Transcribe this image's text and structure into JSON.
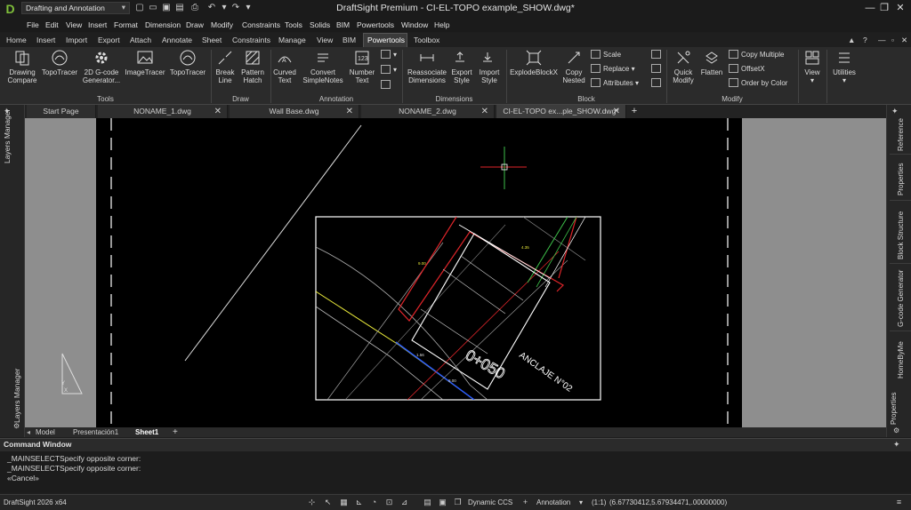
{
  "app": {
    "title": "DraftSight Premium - CI-EL-TOPO example_SHOW.dwg*",
    "workspace": "Drafting and Annotation",
    "version": "DraftSight 2026 x64"
  },
  "menu": [
    "File",
    "Edit",
    "View",
    "Insert",
    "Format",
    "Dimension",
    "Draw",
    "Modify",
    "Constraints",
    "Tools",
    "Solids",
    "BIM",
    "Powertools",
    "Window",
    "Help"
  ],
  "ribbon_tabs": [
    "Home",
    "Insert",
    "Import",
    "Export",
    "Attach",
    "Annotate",
    "Sheet",
    "Constraints",
    "Manage",
    "View",
    "BIM",
    "Powertools",
    "Toolbox"
  ],
  "ribbon": {
    "tools": {
      "label": "Tools",
      "drawing_compare": "Drawing Compare",
      "topotracer": "TopoTracer",
      "gcode": "2D G-code Generator...",
      "imagetracer": "ImageTracer",
      "topotracer2": "TopoTracer"
    },
    "draw": {
      "label": "Draw",
      "break_line": "Break Line",
      "pattern_hatch": "Pattern Hatch"
    },
    "annotation": {
      "label": "Annotation",
      "curved_text": "Curved Text",
      "convert_simplenotes": "Convert SimpleNotes",
      "number_text": "Number Text"
    },
    "dimensions": {
      "label": "Dimensions",
      "reassociate": "Reassociate Dimensions",
      "export_style": "Export Style",
      "import_style": "Import Style"
    },
    "block": {
      "label": "Block",
      "explodeblockx": "ExplodeBlockX",
      "copy_nested": "Copy Nested",
      "scale": "Scale",
      "replace": "Replace",
      "attributes": "Attributes"
    },
    "modify": {
      "label": "Modify",
      "quick_modify": "Quick Modify",
      "flatten": "Flatten",
      "copy_multiple": "Copy Multiple",
      "offsetx": "OffsetX",
      "order_by_color": "Order by Color"
    },
    "view": "View",
    "utilities": "Utilities"
  },
  "doc_tabs": [
    {
      "label": "Start Page"
    },
    {
      "label": "NONAME_1.dwg"
    },
    {
      "label": "Wall Base.dwg"
    },
    {
      "label": "NONAME_2.dwg"
    },
    {
      "label": "CI-EL-TOPO ex...ple_SHOW.dwg*"
    }
  ],
  "left_panel": {
    "top": "Layers Manager",
    "bottom": "Layers Manager"
  },
  "right_panel": [
    "Reference",
    "Properties",
    "Block Structure",
    "G-code Generator",
    "HomeByMe",
    "Properties"
  ],
  "drawing": {
    "station": "0+050",
    "anclaje": "ANCLAJE N°02",
    "dim_a": "9.00",
    "dim_b": "4.35",
    "dim_c": "1.56",
    "dim_d": "8.00",
    "ucs_y": "Y",
    "ucs_x": "X"
  },
  "layout_tabs": [
    "Model",
    "Presentación1",
    "Sheet1"
  ],
  "command": {
    "title": "Command Window",
    "lines": [
      "_MAINSELECTSpecify opposite corner:",
      "_MAINSELECTSpecify opposite corner:",
      "«Cancel»"
    ]
  },
  "status": {
    "dynamic_ccs": "Dynamic CCS",
    "annotation": "Annotation",
    "scale": "(1:1)",
    "coords": "(6.67730412,5.67934471,.00000000)"
  },
  "colors": {
    "accent": "#7fbf3a",
    "red": "#e0252a",
    "green": "#3ec04a",
    "yellow": "#e8e83a",
    "blue": "#2a5cff"
  }
}
